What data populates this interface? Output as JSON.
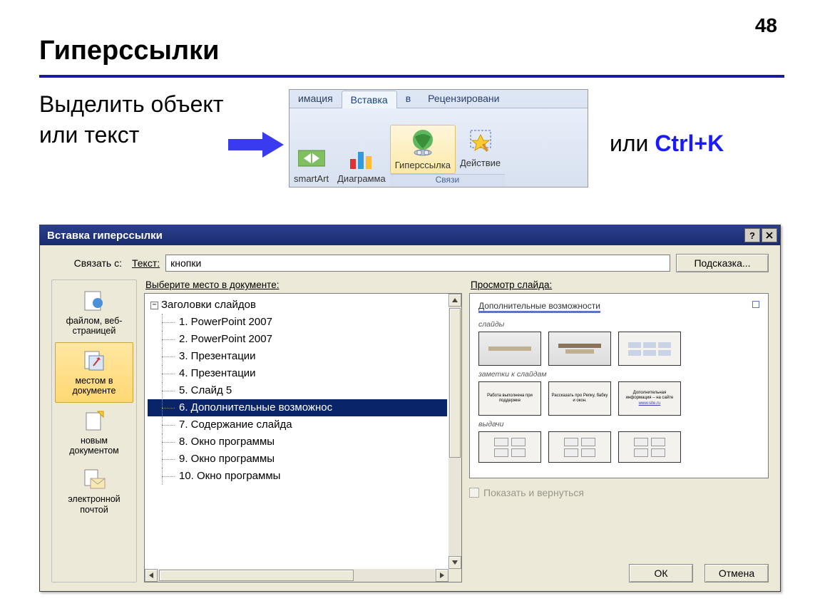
{
  "page_number": "48",
  "title": "Гиперссылки",
  "intro_text": "Выделить объект или текст",
  "ribbon": {
    "tabs": [
      "имация",
      "Вставка",
      "в",
      "Рецензировани"
    ],
    "active_tab_index": 1,
    "items": [
      {
        "label": "smartArt"
      },
      {
        "label": "Диаграмма"
      },
      {
        "label": "Гиперссылка"
      },
      {
        "label": "Действие"
      }
    ],
    "active_item_index": 2,
    "group_label": "Связи"
  },
  "or_label": "или ",
  "shortcut": "Ctrl+K",
  "dialog": {
    "title": "Вставка гиперссылки",
    "link_with_label": "Связать с:",
    "text_label": "Текст:",
    "text_value": "кнопки",
    "hint_button": "Подсказка...",
    "sidebar": [
      "файлом, веб-страницей",
      "местом в документе",
      "новым документом",
      "электронной почтой"
    ],
    "sidebar_active_index": 1,
    "tree_label": "Выберите место в документе:",
    "tree_root": "Заголовки слайдов",
    "tree_items": [
      "1. PowerPoint 2007",
      "2. PowerPoint 2007",
      "3. Презентации",
      "4. Презентации",
      "5. Слайд 5",
      "6. Дополнительные возможнос",
      "7. Содержание слайда",
      "8. Окно программы",
      "9. Окно программы",
      "10. Окно программы"
    ],
    "tree_selected_index": 5,
    "preview_label": "Просмотр слайда:",
    "slide_preview": {
      "title": "Дополнительные возможности",
      "section1": "слайды",
      "section2": "заметки к слайдам",
      "note1": "Работа выполнена при поддержке",
      "note2": "Рассказать про Репку, бабку и окон.",
      "note3_a": "Дополнительная информация – на сайте",
      "note3_link": "www.site.ru",
      "section3": "выдачи"
    },
    "show_return_label": "Показать и вернуться",
    "ok_button": "ОК",
    "cancel_button": "Отмена"
  }
}
